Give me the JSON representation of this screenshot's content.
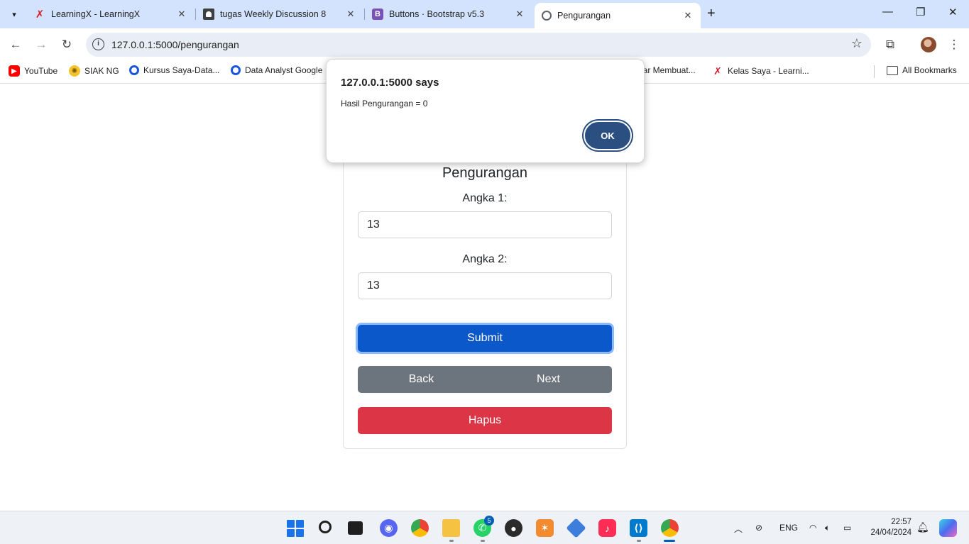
{
  "tabs": [
    {
      "title": "LearningX - LearningX",
      "icon": "learningx-icon"
    },
    {
      "title": "tugas Weekly Discussion 8",
      "icon": "document-icon"
    },
    {
      "title": "Buttons · Bootstrap v5.3",
      "icon": "bootstrap-icon"
    },
    {
      "title": "Pengurangan",
      "icon": "globe-icon",
      "active": true
    }
  ],
  "address_bar": {
    "url": "127.0.0.1:5000/pengurangan"
  },
  "bookmarks": [
    {
      "label": "YouTube"
    },
    {
      "label": "SIAK NG"
    },
    {
      "label": "Kursus Saya-Data..."
    },
    {
      "label": "Data Analyst Google"
    },
    {
      "label": "jar Membuat..."
    },
    {
      "label": "Kelas Saya - Learni..."
    },
    {
      "label": "All Bookmarks"
    }
  ],
  "form": {
    "title": "Pengurangan",
    "label1": "Angka 1:",
    "value1": "13",
    "label2": "Angka 2:",
    "value2": "13",
    "submit": "Submit",
    "back": "Back",
    "next": "Next",
    "hapus": "Hapus"
  },
  "dialog": {
    "title": "127.0.0.1:5000 says",
    "message": "Hasil Pengurangan = 0",
    "ok": "OK"
  },
  "taskbar": {
    "whatsapp_badge": "5",
    "language": "ENG",
    "time": "22:57",
    "date": "24/04/2024"
  },
  "colors": {
    "submit": "#0a58ca",
    "secondary": "#6c757d",
    "danger": "#dc3545",
    "dialog_ok": "#2b4f80"
  }
}
